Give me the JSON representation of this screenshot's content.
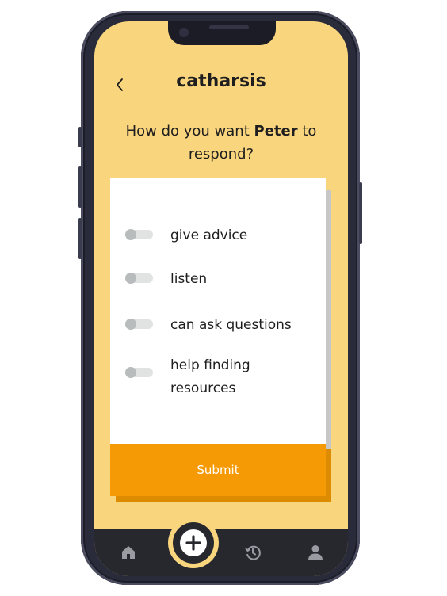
{
  "header": {
    "title": "catharsis",
    "back_icon": "chevron-left-icon"
  },
  "prompt": {
    "prefix": "How do you want ",
    "name": "Peter",
    "suffix": " to respond?"
  },
  "options": [
    {
      "label": "give advice",
      "on": false
    },
    {
      "label": "listen",
      "on": false
    },
    {
      "label": "can ask questions",
      "on": false
    },
    {
      "label": "help finding resources",
      "on": false
    }
  ],
  "submit_label": "Submit",
  "nav": {
    "items": [
      "home-icon",
      "plus-icon",
      "history-icon",
      "user-icon"
    ]
  },
  "colors": {
    "background": "#f9d57e",
    "accent": "#f59a05",
    "nav": "#27272e",
    "frame": "#2a2b3a"
  }
}
